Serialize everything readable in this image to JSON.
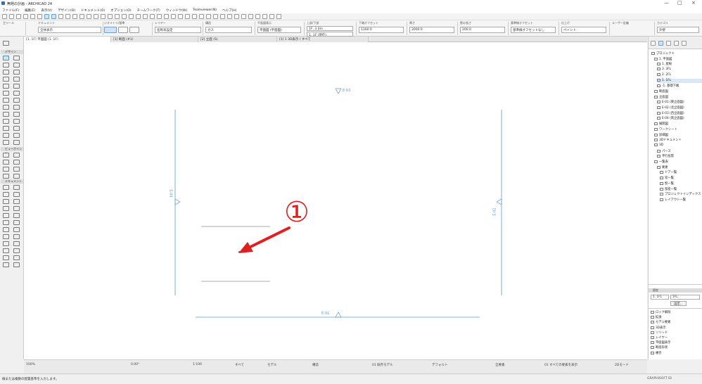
{
  "window": {
    "title": "無題の計画 - ARCHICAD 24",
    "minimize": "—",
    "maximize": "□",
    "close": "×"
  },
  "menu": [
    "ファイル(F)",
    "編集(E)",
    "表示(V)",
    "デザイン(D)",
    "ドキュメント(O)",
    "オプション(O)",
    "チームワーク(T)",
    "ウィンドウ(W)",
    "Teamviewer(N)",
    "ヘルプ(H)"
  ],
  "infobox": {
    "selection_label": "主ツール",
    "view_label": "ドキュメント",
    "view_value": "全体表示",
    "geometry_label": "ジオメトリ/基準",
    "layer_label": "レイヤー",
    "layer_value": "名称未設定",
    "struct_label": "構造",
    "struct_value": "ガス",
    "floor_label": "平面図表示",
    "floor_value": "平面図 (平面図)",
    "height_label": "上部/下部",
    "height_value_1": "1F, 3.0m",
    "height_value_2": "1. 1F (現在)",
    "offset_label": "下端オフセット",
    "offset_value": "1300.0",
    "thickness_label": "厚さ",
    "thickness_value": "3000.0",
    "length_label": "壁の長さ",
    "length_value": "200.0",
    "ref_label": "基準線オフセット",
    "ref_value": "基準線オフセットなし",
    "mat_label": "仕上げ",
    "mat_value": "ペイント",
    "mat_value2": "ユーザー定義",
    "class_label": "カテゴリ",
    "class_value": "外壁"
  },
  "tabs": [
    "[1. 1F] 平面図 (1. 1F)",
    "[1] 断面 (#1)",
    "[2] 立面 (S)",
    "[1] 1 3D表示 / すべて"
  ],
  "toolbox": {
    "design_header": "デザイン",
    "viewpoint_header": "ビューポイント",
    "document_header": "ドキュメント"
  },
  "canvas": {
    "markers": {
      "top": "E-03",
      "left": "E-04",
      "right": "E-02",
      "bottom": "E-01"
    },
    "annotation": "①",
    "colors": {
      "marker": "#5b9bd5",
      "annotation": "#e02020",
      "wall": "#909090"
    }
  },
  "navigator": {
    "tree": [
      "プロジェクト",
      "1. 平面図",
      "1. 屋根",
      "3. 3FL",
      "2. 2FL",
      "1. 1FL",
      "-1. 基礎下端",
      "断面図",
      "立面図",
      "E-01 (東立面図)",
      "E-02 (北立面図)",
      "E-03 (西立面図)",
      "E-04 (南立面図)",
      "展開図",
      "ワークシート",
      "詳細図",
      "3Dドキュメント",
      "3D",
      "パース",
      "平行投影",
      "一覧表",
      "要素",
      "ドア一覧",
      "窓一覧",
      "壁一覧",
      "部屋一覧",
      "プロジェクトインデックス",
      "レイアウト一覧"
    ]
  },
  "properties": {
    "header": "設定",
    "floor_id": "1. 1FL",
    "floor_value": "1FL",
    "settings_button": "設定...",
    "list": [
      "ロック解除",
      "拡張",
      "モデル要素",
      "3D表示",
      "ソリッド",
      "レイヤー",
      "平面図表示",
      "断面形状",
      "複合"
    ]
  },
  "quickbar": {
    "zoom": "100%",
    "angle": "0.00°",
    "scale": "1:100",
    "layer_combo": "すべて",
    "pen_set": "モデル",
    "struct_display": "構造",
    "model_filter": "01 既存モデル",
    "dim_style": "デフォルト",
    "renovation": "全要素",
    "status_right": "01 すべての要素を表示",
    "extra": "2Dモード"
  },
  "status": {
    "message": "線または複数の配置基準を入力します。",
    "right": "GRAPHISOFT ID"
  }
}
